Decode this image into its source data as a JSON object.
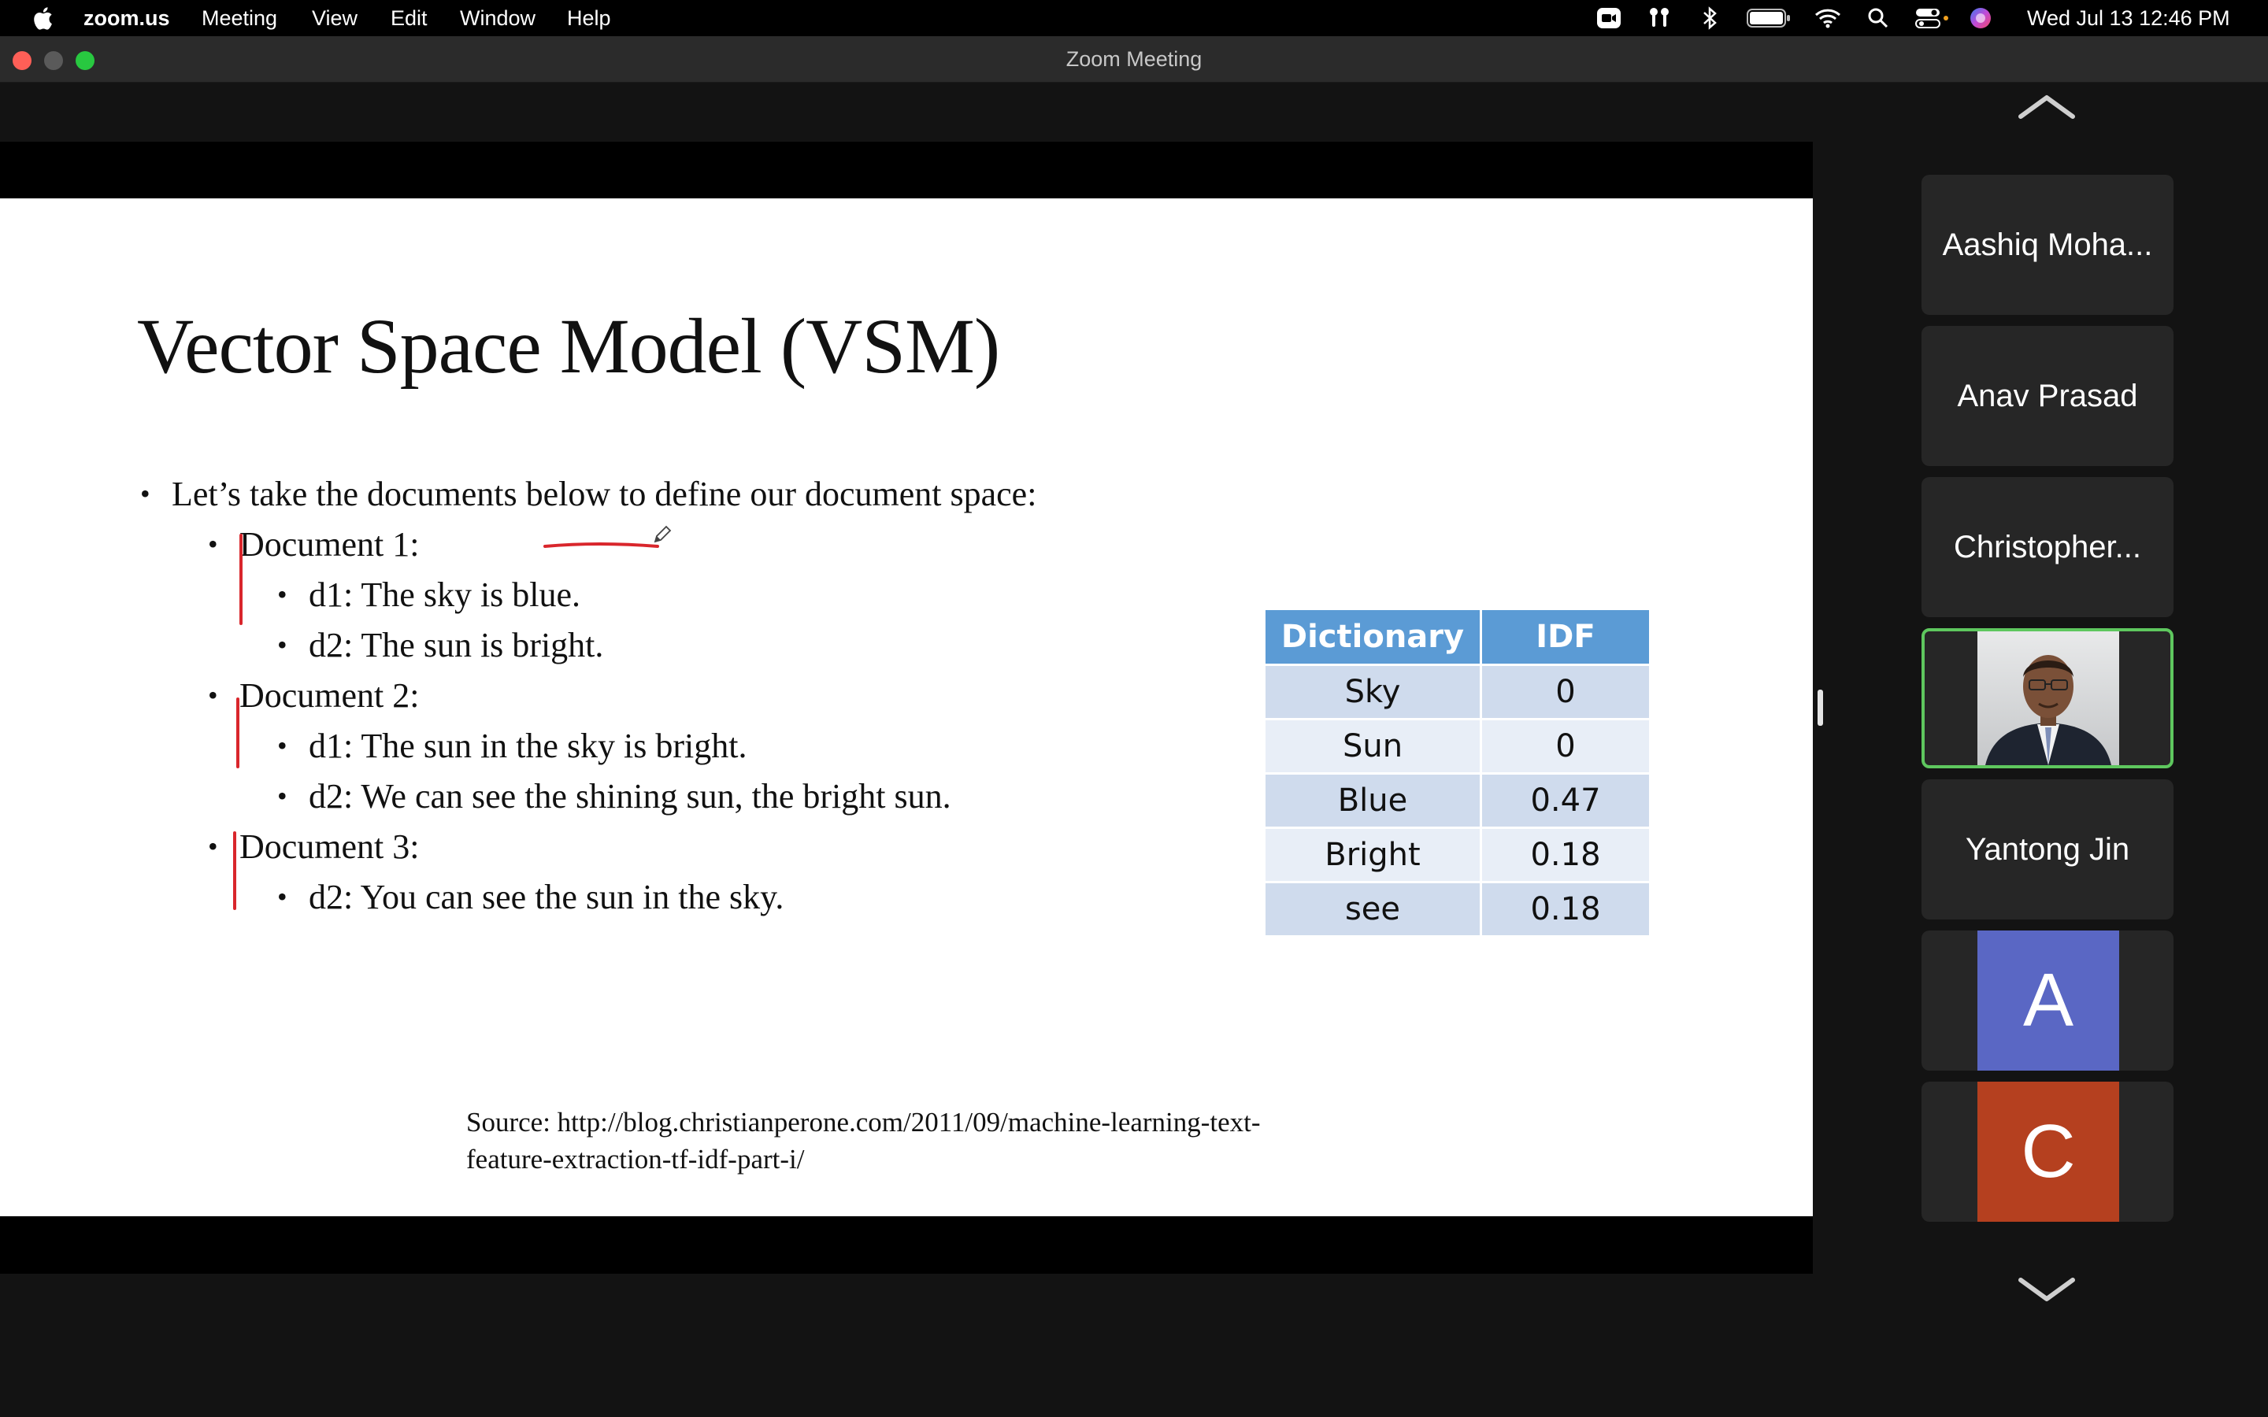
{
  "menubar": {
    "app_name": "zoom.us",
    "items": [
      "Meeting",
      "View",
      "Edit",
      "Window",
      "Help"
    ],
    "clock": "Wed Jul 13  12:46 PM"
  },
  "window": {
    "title": "Zoom Meeting"
  },
  "slide": {
    "title": "Vector Space Model (VSM)",
    "intro": "Let’s take the documents below to define our document space:",
    "doc1": "Document 1:",
    "doc1_d1": "d1: The sky is blue.",
    "doc1_d2": "d2: The sun is bright.",
    "doc2": "Document 2:",
    "doc2_d1": "d1: The sun in the sky is bright.",
    "doc2_d2": "d2: We can see the shining sun, the bright sun.",
    "doc3": "Document 3:",
    "doc3_d2": "d2: You can see the sun in the sky.",
    "source_line1": "Source: http://blog.christianperone.com/2011/09/machine-learning-text-",
    "source_line2": "feature-extraction-tf-idf-part-i/",
    "table": {
      "headers": [
        "Dictionary",
        "IDF"
      ],
      "rows": [
        [
          "Sky",
          "0"
        ],
        [
          "Sun",
          "0"
        ],
        [
          "Blue",
          "0.47"
        ],
        [
          "Bright",
          "0.18"
        ],
        [
          "see",
          "0.18"
        ]
      ],
      "header_color": "#5b9bd5"
    },
    "annotation_color": "#d9262c"
  },
  "participants": [
    {
      "name": "Aashiq Moha..."
    },
    {
      "name": "Anav Prasad"
    },
    {
      "name": "Christopher..."
    },
    {
      "name": "",
      "video": true
    },
    {
      "name": "Yantong Jin"
    },
    {
      "initial": "A",
      "color": "#5a67c4"
    },
    {
      "initial": "C",
      "color": "#b5401f"
    }
  ],
  "active_speaker_color": "#5ec75e"
}
